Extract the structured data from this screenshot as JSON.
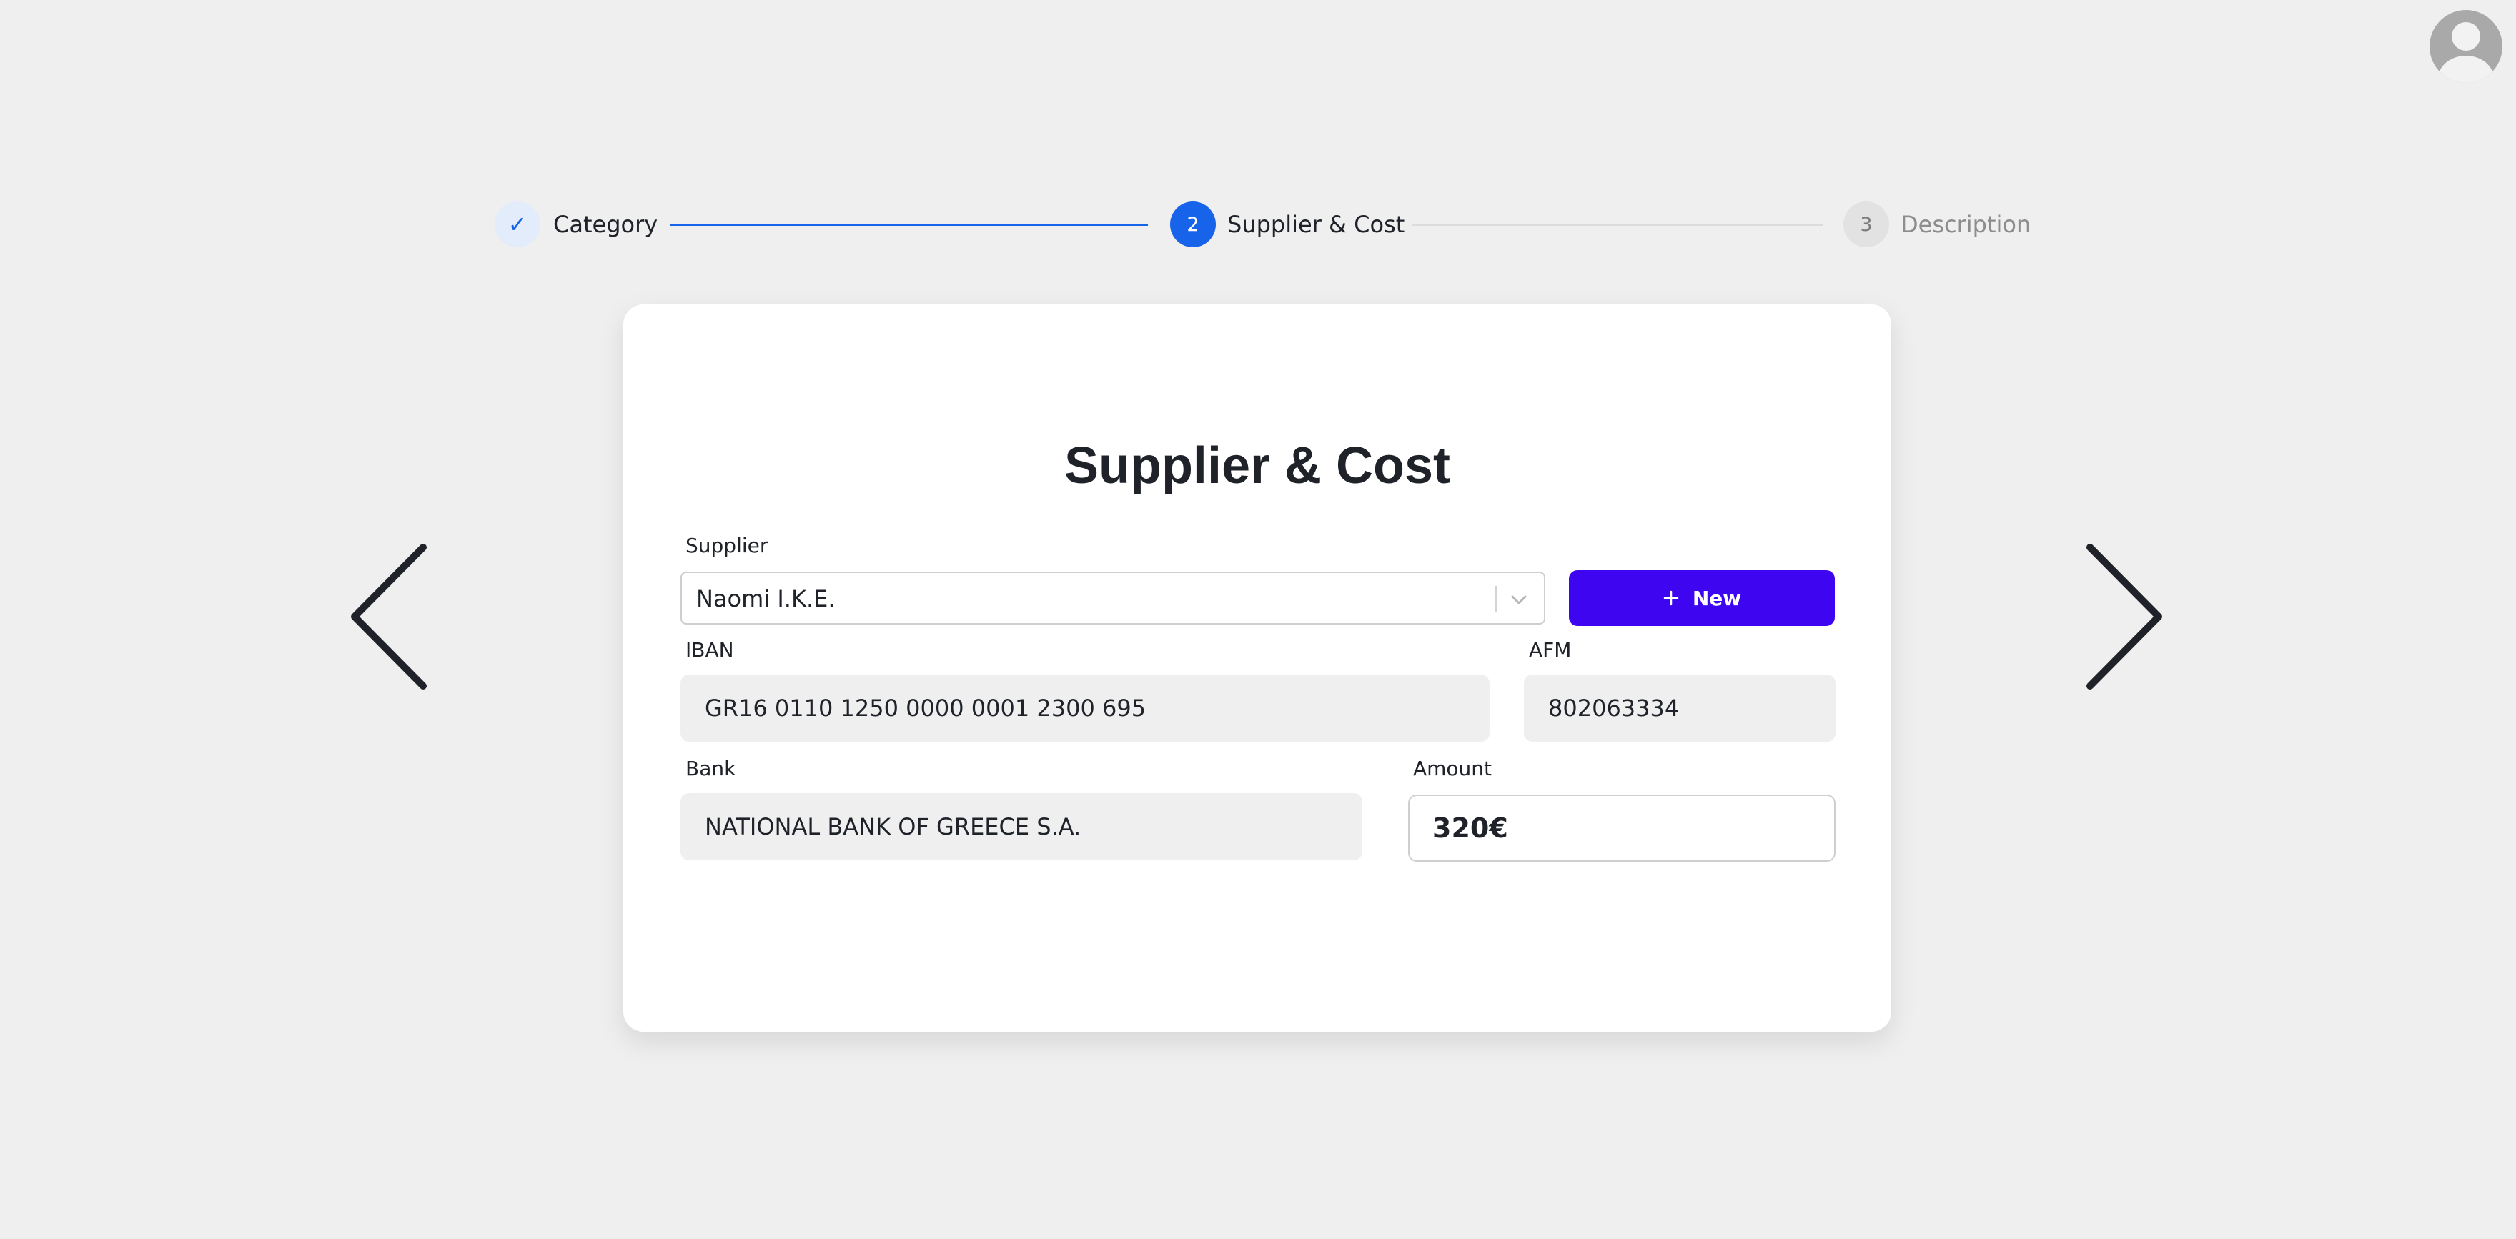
{
  "stepper": {
    "steps": [
      {
        "marker": "✓",
        "label": "Category",
        "state": "completed"
      },
      {
        "marker": "2",
        "label": "Supplier & Cost",
        "state": "active"
      },
      {
        "marker": "3",
        "label": "Description",
        "state": "pending"
      }
    ]
  },
  "form": {
    "title": "Supplier & Cost",
    "supplier": {
      "label": "Supplier",
      "value": "Naomi I.K.E."
    },
    "new_button": {
      "label": "New",
      "icon": "plus-icon"
    },
    "iban": {
      "label": "IBAN",
      "value": "GR16 0110 1250 0000 0001 2300 695"
    },
    "afm": {
      "label": "AFM",
      "value": "802063334"
    },
    "bank": {
      "label": "Bank",
      "value": "NATIONAL BANK OF GREECE S.A."
    },
    "amount": {
      "label": "Amount",
      "value": "320€"
    }
  },
  "navigation": {
    "prev_icon": "chevron-left-icon",
    "next_icon": "chevron-right-icon"
  },
  "user": {
    "avatar_icon": "user-avatar-icon"
  },
  "colors": {
    "background": "#efefef",
    "accent": "#1763ea",
    "primary_button": "#3d05f0",
    "card": "#ffffff"
  }
}
